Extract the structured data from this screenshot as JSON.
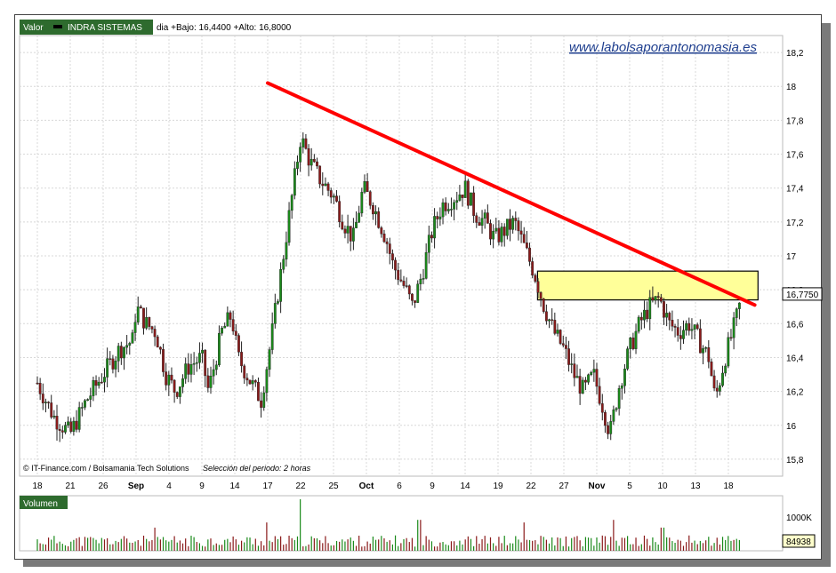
{
  "header": {
    "label": "Valor",
    "symbol": "INDRA SISTEMAS",
    "range": "dia +Bajo: 16,4400 +Alto: 16,8000"
  },
  "watermark": "www.labolsaporantonomasia.es",
  "credit": "© IT-Finance.com / Bolsamania Tech Solutions",
  "period": "Selección del periodo: 2 horas",
  "volume_panel": {
    "label": "Volumen",
    "scale_label": "1000K",
    "last_value": "84938"
  },
  "colors": {
    "up": "#1a8a1a",
    "down": "#8a1a1a",
    "trendline": "#ff0000",
    "zone_fill": "#ffff99",
    "panel_header": "#2e6b2e"
  },
  "chart_data": {
    "type": "candlestick",
    "y_axis": {
      "min": 15.7,
      "max": 18.3,
      "ticks": [
        "18,2",
        "18",
        "17,8",
        "17,6",
        "17,4",
        "17,2",
        "17",
        "16,8",
        "16,6",
        "16,4",
        "16,2",
        "16",
        "15,8"
      ],
      "tick_values": [
        18.2,
        18.0,
        17.8,
        17.6,
        17.4,
        17.2,
        17.0,
        16.8,
        16.6,
        16.4,
        16.2,
        16.0,
        15.8
      ],
      "last_price_label": "16,7750",
      "last_price": 16.775
    },
    "x_axis": {
      "labels": [
        "18",
        "21",
        "26",
        "Sep",
        "4",
        "9",
        "14",
        "17",
        "22",
        "25",
        "Oct",
        "6",
        "9",
        "14",
        "19",
        "22",
        "27",
        "Nov",
        "5",
        "10",
        "13",
        "18"
      ],
      "bold": [
        "Sep",
        "Oct",
        "Nov"
      ]
    },
    "trendline": {
      "from": {
        "x_index": 7.0,
        "price": 18.02
      },
      "to": {
        "x_index": 21.8,
        "price": 16.71
      }
    },
    "resistance_zone": {
      "x_from_index": 15.2,
      "x_to_index": 21.9,
      "low": 16.74,
      "high": 16.91
    },
    "price_path": [
      [
        0.0,
        16.25
      ],
      [
        0.5,
        16.05
      ],
      [
        1.0,
        15.95
      ],
      [
        1.5,
        16.15
      ],
      [
        2.0,
        16.3
      ],
      [
        2.5,
        16.45
      ],
      [
        2.9,
        16.5
      ],
      [
        3.0,
        16.7
      ],
      [
        3.3,
        16.6
      ],
      [
        3.6,
        16.55
      ],
      [
        3.9,
        16.3
      ],
      [
        4.2,
        16.2
      ],
      [
        4.6,
        16.35
      ],
      [
        5.0,
        16.4
      ],
      [
        5.2,
        16.2
      ],
      [
        5.6,
        16.55
      ],
      [
        5.9,
        16.65
      ],
      [
        6.1,
        16.4
      ],
      [
        6.5,
        16.25
      ],
      [
        6.8,
        16.15
      ],
      [
        7.1,
        16.5
      ],
      [
        7.4,
        16.9
      ],
      [
        7.7,
        17.3
      ],
      [
        8.0,
        17.7
      ],
      [
        8.3,
        17.55
      ],
      [
        8.6,
        17.45
      ],
      [
        9.0,
        17.35
      ],
      [
        9.3,
        17.2
      ],
      [
        9.6,
        17.1
      ],
      [
        9.9,
        17.4
      ],
      [
        10.2,
        17.3
      ],
      [
        10.6,
        17.1
      ],
      [
        10.8,
        16.95
      ],
      [
        11.2,
        16.8
      ],
      [
        11.4,
        16.7
      ],
      [
        11.7,
        16.9
      ],
      [
        12.0,
        17.15
      ],
      [
        12.3,
        17.3
      ],
      [
        12.7,
        17.35
      ],
      [
        13.0,
        17.4
      ],
      [
        13.3,
        17.25
      ],
      [
        13.6,
        17.2
      ],
      [
        13.9,
        17.1
      ],
      [
        14.2,
        17.15
      ],
      [
        14.5,
        17.2
      ],
      [
        14.8,
        17.05
      ],
      [
        15.1,
        16.9
      ],
      [
        15.4,
        16.7
      ],
      [
        15.7,
        16.55
      ],
      [
        16.0,
        16.45
      ],
      [
        16.3,
        16.3
      ],
      [
        16.6,
        16.2
      ],
      [
        16.9,
        16.3
      ],
      [
        17.2,
        16.1
      ],
      [
        17.4,
        15.95
      ],
      [
        17.7,
        16.25
      ],
      [
        18.0,
        16.45
      ],
      [
        18.3,
        16.6
      ],
      [
        18.6,
        16.7
      ],
      [
        18.9,
        16.75
      ],
      [
        19.2,
        16.6
      ],
      [
        19.5,
        16.55
      ],
      [
        19.8,
        16.6
      ],
      [
        20.1,
        16.5
      ],
      [
        20.4,
        16.4
      ],
      [
        20.6,
        16.15
      ],
      [
        20.9,
        16.4
      ],
      [
        21.2,
        16.6
      ],
      [
        21.4,
        16.75
      ]
    ],
    "volume_spikes": [
      [
        8.0,
        1.0
      ],
      [
        7.0,
        0.55
      ],
      [
        3.6,
        0.45
      ],
      [
        11.6,
        0.6
      ],
      [
        14.8,
        0.55
      ],
      [
        17.5,
        0.6
      ],
      [
        19.0,
        0.45
      ]
    ]
  }
}
